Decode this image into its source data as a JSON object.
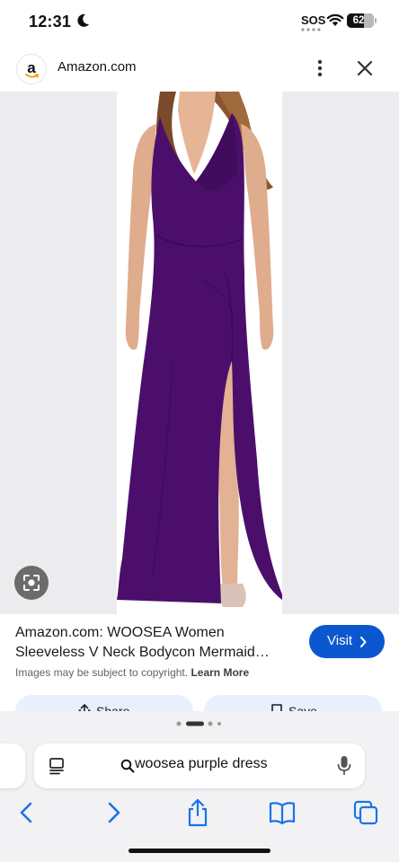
{
  "status_bar": {
    "time": "12:31",
    "sos": "SOS",
    "battery": "62",
    "battery_level": 0.62,
    "icons": [
      "moon-icon",
      "wifi-icon",
      "battery-icon"
    ]
  },
  "header": {
    "favicon_letter": "a",
    "site_title": "Amazon.com",
    "icons": [
      "more-icon",
      "close-icon"
    ]
  },
  "colors": {
    "dress": "#4b0f6b",
    "visit_button": "#0b57d0",
    "chip_background": "#e8f0fe",
    "image_background": "#ececef"
  },
  "result": {
    "title": "Amazon.com: WOOSEA Women Sleeveless V Neck Bodycon Mermaid…",
    "visit_label": "Visit",
    "copyright_text": "Images may be subject to copyright.",
    "learn_more": "Learn More",
    "share_label": "Share",
    "save_label": "Save"
  },
  "browser": {
    "search_query": "woosea purple dress",
    "toolbar_icons": [
      "back-icon",
      "forward-icon",
      "share-icon",
      "bookmarks-icon",
      "tabs-icon"
    ]
  }
}
